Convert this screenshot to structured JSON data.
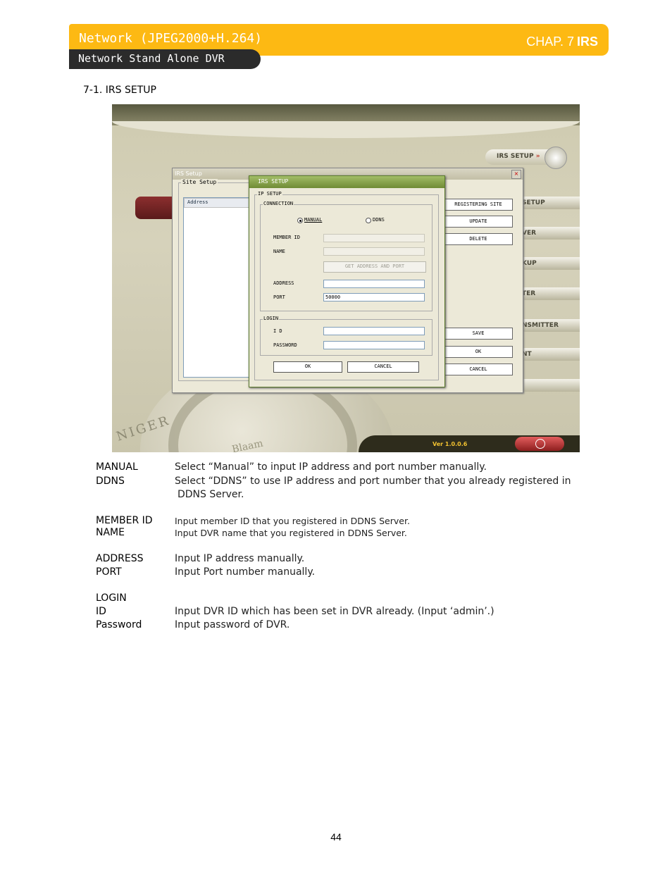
{
  "header": {
    "title": "Network (JPEG2000+H.264)",
    "chapter_prefix": "CHAP. 7",
    "chapter_name": "IRS",
    "subtitle": "Network Stand Alone DVR"
  },
  "section_title": "7-1. IRS SETUP",
  "screenshot": {
    "irs_setup_button": "IRS SETUP",
    "irs_setup_arrows": "»",
    "side_buttons": [
      "SETUP",
      "VER",
      "KUP",
      "TER",
      "NSMITTER",
      "NT"
    ],
    "version": "Ver 1.0.0.6",
    "globe_text": "NIGER",
    "globe_text2": "Blaam",
    "site_dialog": {
      "title": "IRS Setup",
      "close": "×",
      "site_group": "Site Setup",
      "list_header": "Address",
      "buttons": [
        "REGISTERING SITE",
        "UPDATE",
        "DELETE",
        "SAVE",
        "OK",
        "CANCEL"
      ]
    },
    "irs_dialog": {
      "title": "IRS SETUP",
      "ip_group": "IP SETUP",
      "connection_group": "CONNECTION",
      "manual": "MANUAL",
      "ddns": "DDNS",
      "member_id": "MEMBER ID",
      "name": "NAME",
      "get_button": "GET ADDRESS AND PORT",
      "address": "ADDRESS",
      "port": "PORT",
      "port_value": "50000",
      "login_group": "LOGIN",
      "id": "I D",
      "password": "PASSWORD",
      "ok": "OK",
      "cancel": "CANCEL"
    }
  },
  "descriptions": [
    {
      "term": "MANUAL",
      "text": "Select “Manual” to input IP address and port number manually."
    },
    {
      "term": "DDNS",
      "text": "Select “DDNS” to use IP address and port number that you already registered in",
      "text2": "DDNS Server."
    },
    {
      "term": "MEMBER ID",
      "text": "Input member ID that you registered in DDNS Server."
    },
    {
      "term": "NAME",
      "text": "Input DVR name that you registered in DDNS Server."
    },
    {
      "term": "ADDRESS",
      "text": "Input IP address manually."
    },
    {
      "term": "PORT",
      "text": "Input Port number manually."
    },
    {
      "term": "LOGIN",
      "text": ""
    },
    {
      "term": "ID",
      "text": "Input DVR ID which has been set in DVR already. (Input ‘admin’.)"
    },
    {
      "term": "Password",
      "text": "Input password of DVR."
    }
  ],
  "page_number": "44"
}
